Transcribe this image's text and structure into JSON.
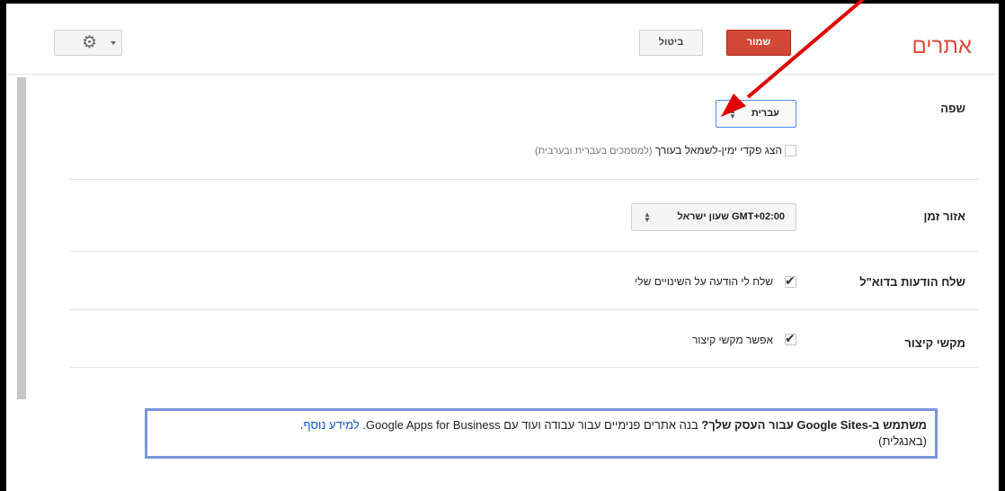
{
  "header": {
    "title": "אתרים",
    "save_label": "שמור",
    "cancel_label": "ביטול",
    "settings_icon": "gear-icon"
  },
  "language": {
    "label": "שפה",
    "selected": "עברית",
    "rtl_checkbox_label": "הצג פקדי ימין-לשמאל בעורך",
    "rtl_checkbox_hint": "(למסמכים בעברית ובערבית)",
    "rtl_checked": false
  },
  "timezone": {
    "label": "אזור זמן",
    "selected": "GMT+02:00 שעון ישראל"
  },
  "email": {
    "label": "שלח הודעות בדוא\"ל",
    "checkbox_label": "שלח לי הודעה על השינויים שלי",
    "checked": true
  },
  "shortcuts": {
    "label": "מקשי קיצור",
    "checkbox_label": "אפשר מקשי קיצור",
    "checked": true
  },
  "promo": {
    "bold_text": "משתמש ב-Google Sites עבור העסק שלך?",
    "text": " בנה אתרים פנימיים עבור עבודה ועוד עם Google Apps for Business. ",
    "link": "למידע נוסף",
    "link_suffix": ".",
    "note": "(באנגלית)"
  },
  "colors": {
    "accent_red": "#dd4b39",
    "save_button": "#d14836",
    "link": "#1155cc",
    "promo_border": "#7b95de",
    "annotation_arrow": "#e00000"
  }
}
